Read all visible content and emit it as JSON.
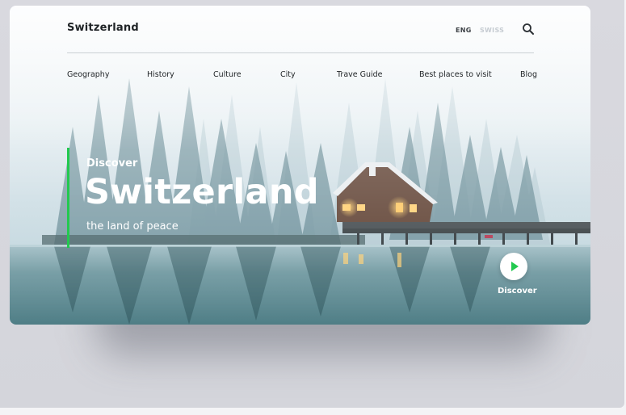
{
  "brand": "Switzerland",
  "languages": {
    "active": "ENG",
    "inactive": "SWISS"
  },
  "icons": {
    "search": "search-icon",
    "play": "play-icon"
  },
  "nav": [
    {
      "label": "Geography"
    },
    {
      "label": "History"
    },
    {
      "label": "Culture"
    },
    {
      "label": "City"
    },
    {
      "label": "Trave Guide"
    },
    {
      "label": "Best places to visit"
    },
    {
      "label": "Blog"
    }
  ],
  "hero": {
    "kicker": "Discover",
    "title": "Switzerland",
    "subtitle": "the land of peace"
  },
  "cta": {
    "label": "Discover"
  },
  "colors": {
    "accent": "#22c94f",
    "text_dark": "#1f2326",
    "hero_text": "#ffffff"
  }
}
